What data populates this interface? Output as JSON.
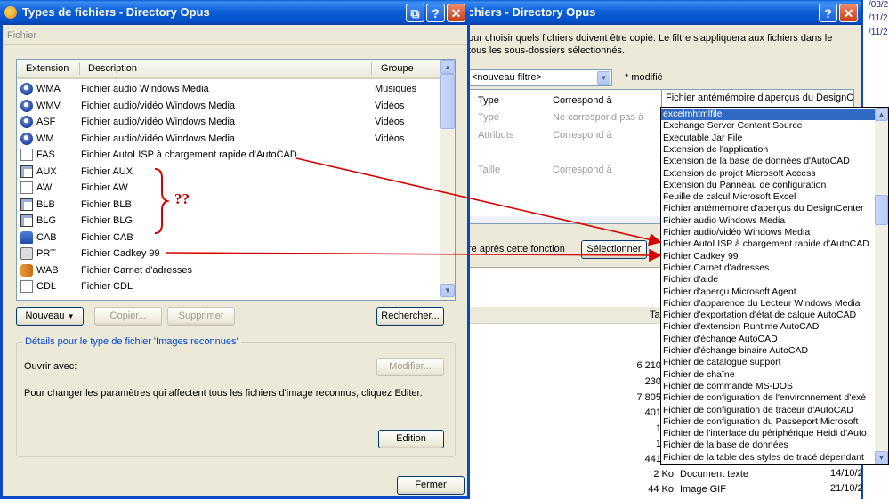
{
  "front_window": {
    "title": "Types de fichiers - Directory Opus",
    "menu_label": "Fichier",
    "columns": [
      "Extension",
      "Description",
      "Groupe"
    ],
    "rows": [
      {
        "ext": "WMA",
        "desc": "Fichier audio Windows Media",
        "group": "Musiques",
        "icon": "media-icon"
      },
      {
        "ext": "WMV",
        "desc": "Fichier audio/vidéo Windows Media",
        "group": "Vidéos",
        "icon": "media-icon"
      },
      {
        "ext": "ASF",
        "desc": "Fichier audio/vidéo Windows Media",
        "group": "Vidéos",
        "icon": "media-icon"
      },
      {
        "ext": "WM",
        "desc": "Fichier audio/vidéo Windows Media",
        "group": "Vidéos",
        "icon": "media-icon"
      },
      {
        "ext": "FAS",
        "desc": "Fichier AutoLISP à chargement rapide d'AutoCAD",
        "group": "",
        "icon": "document-icon"
      },
      {
        "ext": "AUX",
        "desc": "Fichier AUX",
        "group": "",
        "icon": "cad-icon"
      },
      {
        "ext": "AW",
        "desc": "Fichier AW",
        "group": "",
        "icon": "document-icon"
      },
      {
        "ext": "BLB",
        "desc": "Fichier BLB",
        "group": "",
        "icon": "cad-icon"
      },
      {
        "ext": "BLG",
        "desc": "Fichier BLG",
        "group": "",
        "icon": "cad-icon"
      },
      {
        "ext": "CAB",
        "desc": "Fichier CAB",
        "group": "",
        "icon": "cabinet-icon"
      },
      {
        "ext": "PRT",
        "desc": "Fichier Cadkey 99",
        "group": "",
        "icon": "cadkey-icon"
      },
      {
        "ext": "WAB",
        "desc": "Fichier Carnet d'adresses",
        "group": "",
        "icon": "address-book-icon"
      },
      {
        "ext": "CDL",
        "desc": "Fichier CDL",
        "group": "",
        "icon": "document-icon"
      }
    ],
    "buttons": {
      "nouveau": "Nouveau",
      "copier": "Copier...",
      "supprimer": "Supprimer",
      "rechercher": "Rechercher...",
      "modifier": "Modifier...",
      "edition": "Edition",
      "fermer": "Fermer"
    },
    "details": {
      "legend": "Détails pour le type de fichier 'Images reconnues'",
      "ouvrir_label": "Ouvrir avec:",
      "info_text": "Pour changer les paramètres qui affectent tous les fichiers d'image reconnus, cliquez Editer."
    },
    "annotation": "??"
  },
  "back_window": {
    "title": "ichiers - Directory Opus",
    "intro_line1": "our choisir quels fichiers doivent être copié. Le filtre s'appliquera aux fichiers dans le",
    "intro_line2": "tous les sous-dossiers sélectionnés.",
    "filter_select": "<nouveau filtre>",
    "modified_label": "* modifié",
    "criteria": [
      {
        "name": "Type",
        "value": "Correspond à",
        "faded": false
      },
      {
        "name": "Type",
        "value": "Ne correspond pas à",
        "faded": true
      },
      {
        "name": "Attributs",
        "value": "Correspond à",
        "faded": true
      },
      {
        "name": "Taille",
        "value": "Correspond à",
        "faded": true
      }
    ],
    "type_value": "Fichier antémémoire d'aperçus du DesignCe",
    "after_function": "re après cette fonction",
    "select_button": "Sélectionner",
    "size_header": "Ta",
    "sizes": [
      "6 210",
      "230",
      "7 805",
      "401",
      "1",
      "1",
      "441"
    ],
    "bottom_rows": [
      {
        "size": "2 Ko",
        "type": "Document texte",
        "date": "14/10/2"
      },
      {
        "size": "44 Ko",
        "type": "Image GIF",
        "date": "21/10/2"
      }
    ]
  },
  "background_dates": [
    "/03/2",
    "/11/2",
    "/11/2"
  ],
  "dropdown": {
    "selected_index": 0,
    "items": [
      "excelmhtmlfile",
      "Exchange Server Content Source",
      "Executable Jar File",
      "Extension de l'application",
      "Extension de la base de données d'AutoCAD",
      "Extension de projet Microsoft Access",
      "Extension du Panneau de configuration",
      "Feuille de calcul Microsoft Excel",
      "Fichier antémémoire d'aperçus du DesignCenter",
      "Fichier audio Windows Media",
      "Fichier audio/vidéo Windows Media",
      "Fichier AutoLISP à chargement rapide d'AutoCAD",
      "Fichier Cadkey 99",
      "Fichier Carnet d'adresses",
      "Fichier d'aide",
      "Fichier d'aperçu Microsoft Agent",
      "Fichier d'apparence du Lecteur Windows Media",
      "Fichier d'exportation d'état de calque AutoCAD",
      "Fichier d'extension Runtime AutoCAD",
      "Fichier d'échange AutoCAD",
      "Fichier d'échange binaire AutoCAD",
      "Fichier de catalogue support",
      "Fichier de chaîne",
      "Fichier de commande MS-DOS",
      "Fichier de configuration de l'environnement d'exé",
      "Fichier de configuration de traceur d'AutoCAD",
      "Fichier de configuration du Passeport Microsoft",
      "Fichier de l'interface du périphérique Heidi d'Auto",
      "Fichier de la base de données",
      "Fichier de la table des styles de tracé dépendant"
    ]
  },
  "colors": {
    "title_blue": "#0a5fd8",
    "selection": "#316ac5",
    "arrow_red": "#d40000",
    "dialog_bg": "#ece9d8"
  }
}
